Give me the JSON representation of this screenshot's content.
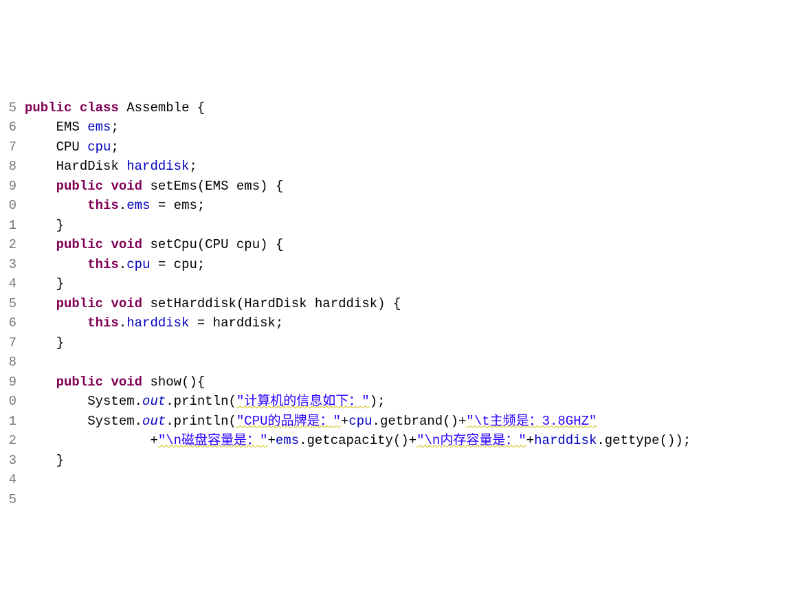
{
  "lines": {
    "n5": "5",
    "n6": "6",
    "n7": "7",
    "n8": "8",
    "n9": "9",
    "n10": "0",
    "n11": "1",
    "n12": "2",
    "n13": "3",
    "n14": "4",
    "n15": "5",
    "n16": "6",
    "n17": "7",
    "n18": "8",
    "n19": "9",
    "n20": "0",
    "n21": "1",
    "n22": "2",
    "n23": "3",
    "n24": "4",
    "n25": "5"
  },
  "indicators": {
    "i9": "⊖",
    "i12": "⊖",
    "i15": "⊖",
    "i19": "⊖"
  },
  "tokens": {
    "kw_public": "public",
    "kw_class": "class",
    "kw_void": "void",
    "kw_this": "this",
    "cls_name": "Assemble",
    "type_ems": "EMS",
    "type_cpu": "CPU",
    "type_hd": "HardDisk",
    "fld_ems": "ems",
    "fld_cpu": "cpu",
    "fld_hd": "harddisk",
    "m_setEms": "setEms",
    "m_setCpu": "setCpu",
    "m_setHd": "setHarddisk",
    "m_show": "show",
    "p_ems": "ems",
    "p_cpu": "cpu",
    "p_hd": "harddisk",
    "sys": "System",
    "out": "out",
    "println": "println",
    "m_getbrand": "getbrand",
    "m_getcap": "getcapacity",
    "m_gettype": "gettype",
    "str1": "\"计算机的信息如下：\"",
    "str2a": "\"CPU的品牌是：\"",
    "str2b": "\"\\t主频是：3.8GHZ\"",
    "str3a": "\"\\n磁盘容量是：\"",
    "str3b": "\"\\n内存容量是：\"",
    "lbrace": "{",
    "rbrace": "}",
    "lpar": "(",
    "rpar": ")",
    "semi": ";",
    "dot": ".",
    "eq": " = ",
    "plus": "+",
    "sp": " "
  }
}
